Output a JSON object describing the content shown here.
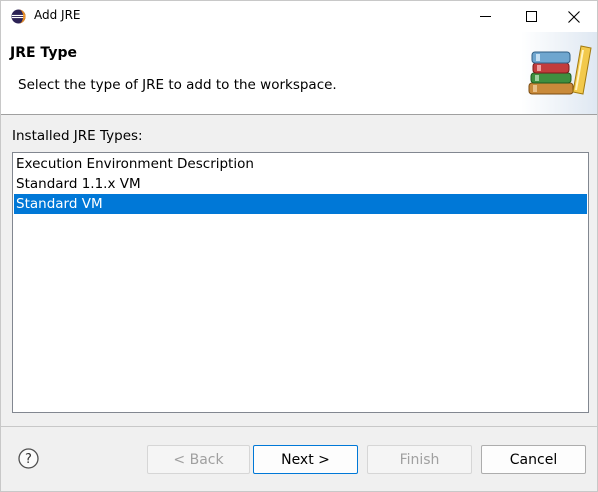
{
  "window": {
    "title": "Add JRE",
    "icon": "eclipse-icon"
  },
  "header": {
    "title": "JRE Type",
    "description": "Select the type of JRE to add to the workspace.",
    "banner_icon": "books-icon"
  },
  "main": {
    "installed_label": "Installed JRE Types:",
    "items": [
      {
        "label": "Execution Environment Description",
        "selected": false
      },
      {
        "label": "Standard 1.1.x VM",
        "selected": false
      },
      {
        "label": "Standard VM",
        "selected": true
      }
    ]
  },
  "footer": {
    "help_icon": "help-icon",
    "back_label": "< Back",
    "next_label": "Next >",
    "finish_label": "Finish",
    "cancel_label": "Cancel"
  },
  "colors": {
    "selection": "#0078d7",
    "accent": "#0078d7"
  }
}
